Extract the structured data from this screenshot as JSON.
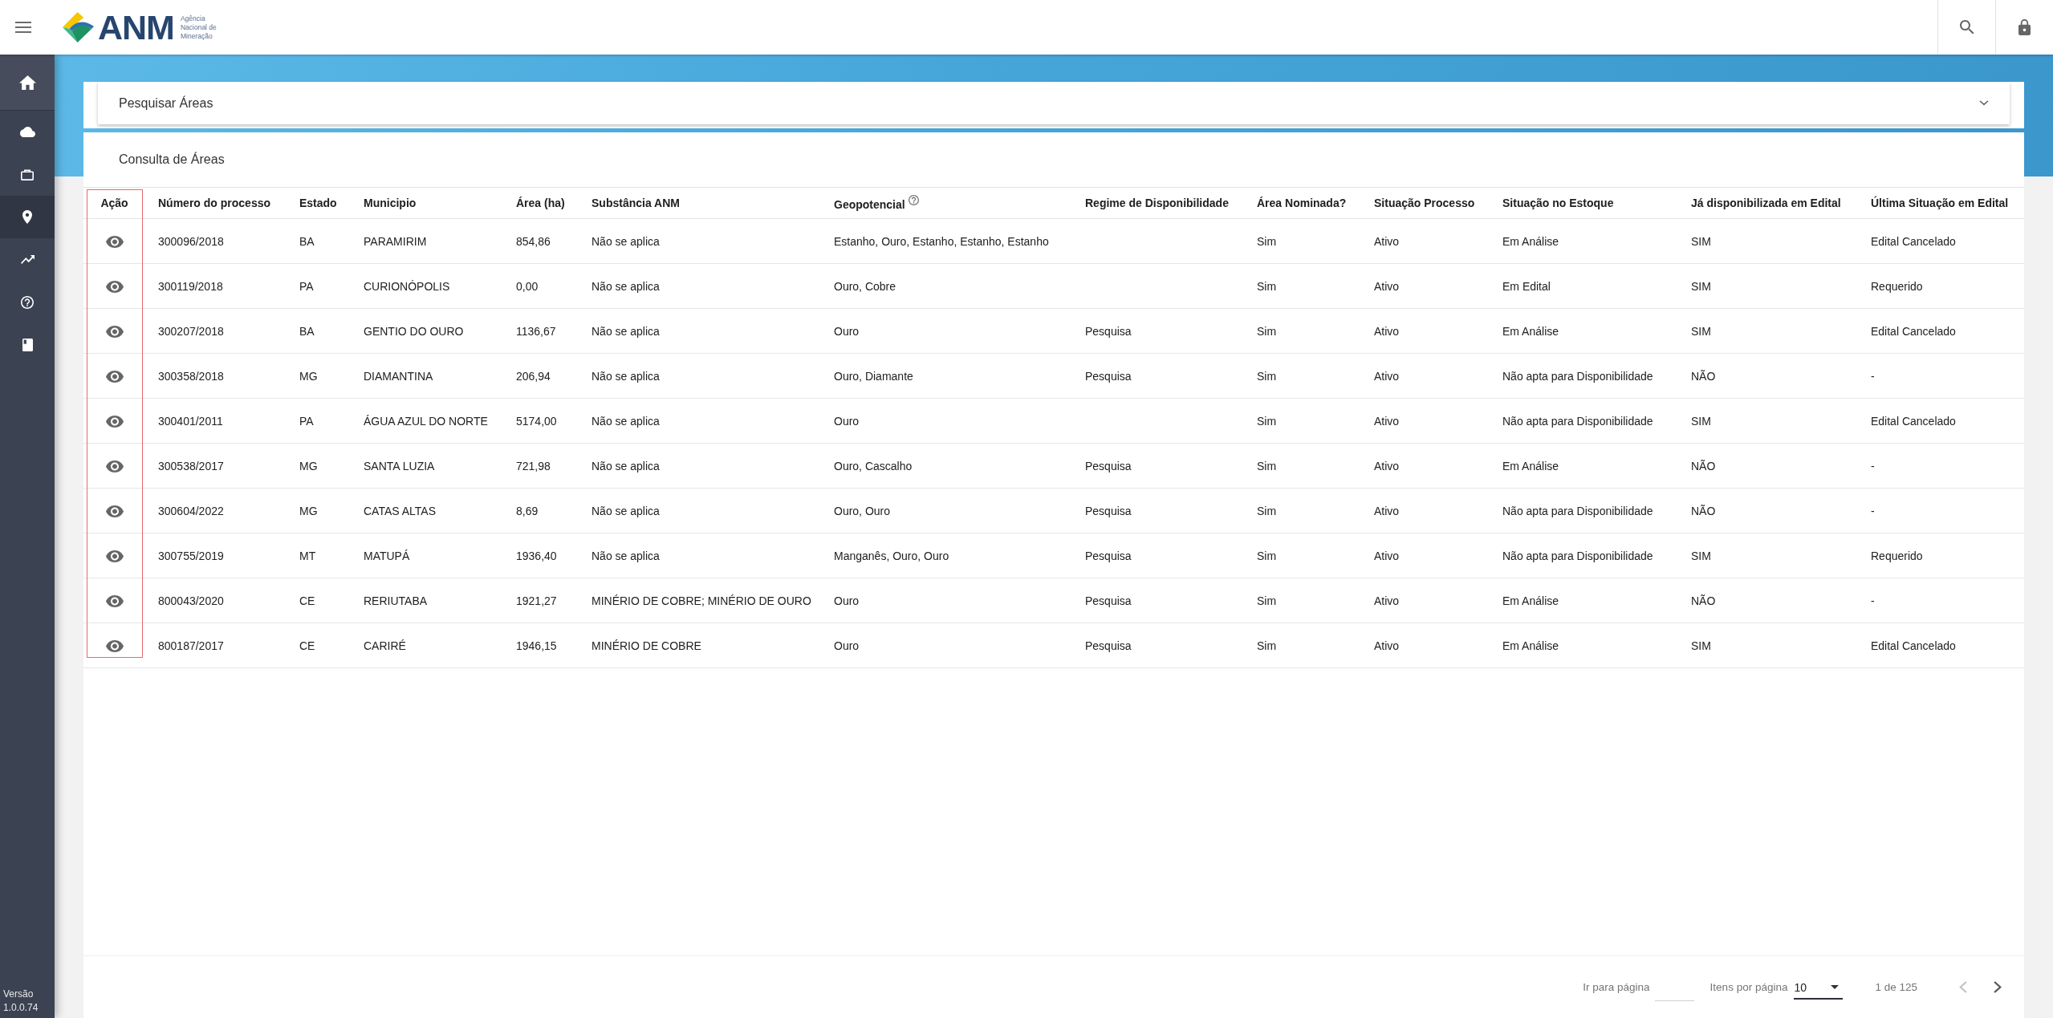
{
  "header": {
    "logo_title": "ANM",
    "logo_subtitle": "Agência Nacional de Mineração"
  },
  "sidebar": {
    "items": [
      {
        "kind": "home",
        "selected": false
      },
      {
        "kind": "cloud",
        "selected": false
      },
      {
        "kind": "briefcase",
        "selected": false
      },
      {
        "kind": "pin",
        "selected": true
      },
      {
        "kind": "trend",
        "selected": false
      },
      {
        "kind": "help",
        "selected": false
      },
      {
        "kind": "book",
        "selected": false
      }
    ],
    "version_label": "Versão",
    "version": "1.0.0.74"
  },
  "search_panel": {
    "title": "Pesquisar Áreas",
    "expanded": false
  },
  "results": {
    "title": "Consulta de Áreas",
    "table": {
      "columns": [
        {
          "kind": "action",
          "label": "Ação",
          "help": false,
          "highlighted": true
        },
        {
          "kind": "text",
          "label": "Número do processo",
          "help": false,
          "highlighted": false
        },
        {
          "kind": "text",
          "label": "Estado",
          "help": false,
          "highlighted": false
        },
        {
          "kind": "text",
          "label": "Municipio",
          "help": false,
          "highlighted": false
        },
        {
          "kind": "text",
          "label": "Área (ha)",
          "help": false,
          "highlighted": false
        },
        {
          "kind": "text",
          "label": "Substância ANM",
          "help": false,
          "highlighted": false
        },
        {
          "kind": "text",
          "label": "Geopotencial",
          "help": true,
          "highlighted": false
        },
        {
          "kind": "text",
          "label": "Regime de Disponibilidade",
          "help": false,
          "highlighted": false
        },
        {
          "kind": "text",
          "label": "Área Nominada?",
          "help": false,
          "highlighted": false
        },
        {
          "kind": "text",
          "label": "Situação Processo",
          "help": false,
          "highlighted": false
        },
        {
          "kind": "text",
          "label": "Situação no Estoque",
          "help": false,
          "highlighted": false
        },
        {
          "kind": "text",
          "label": "Já disponibilizada em Edital",
          "help": false,
          "highlighted": false
        },
        {
          "kind": "text",
          "label": "Última Situação em Edital",
          "help": false,
          "highlighted": false
        }
      ],
      "rows": [
        {
          "process_number": "300096/2018",
          "state": "BA",
          "municipality": "PARAMIRIM",
          "area_ha": "854,86",
          "substance_anm": "Não se aplica",
          "geopotential": "Estanho, Ouro, Estanho, Estanho, Estanho",
          "nominated_area": "Sim",
          "process_status": "Ativo",
          "stock_status": "Em Análise",
          "available_in_edital": "SIM",
          "last_edital_status": "Edital Cancelado"
        },
        {
          "process_number": "300119/2018",
          "state": "PA",
          "municipality": "CURIONÓPOLIS",
          "area_ha": "0,00",
          "substance_anm": "Não se aplica",
          "geopotential": "Ouro, Cobre",
          "nominated_area": "Sim",
          "process_status": "Ativo",
          "stock_status": "Em Edital",
          "available_in_edital": "SIM",
          "last_edital_status": "Requerido"
        },
        {
          "process_number": "300207/2018",
          "state": "BA",
          "municipality": "GENTIO DO OURO",
          "area_ha": "1136,67",
          "substance_anm": "Não se aplica",
          "geopotential": "Ouro",
          "availability_regime": "Pesquisa",
          "nominated_area": "Sim",
          "process_status": "Ativo",
          "stock_status": "Em Análise",
          "available_in_edital": "SIM",
          "last_edital_status": "Edital Cancelado"
        },
        {
          "process_number": "300358/2018",
          "state": "MG",
          "municipality": "DIAMANTINA",
          "area_ha": "206,94",
          "substance_anm": "Não se aplica",
          "geopotential": "Ouro, Diamante",
          "availability_regime": "Pesquisa",
          "nominated_area": "Sim",
          "process_status": "Ativo",
          "stock_status": "Não apta para Disponibilidade",
          "available_in_edital": "NÃO",
          "last_edital_status": "-"
        },
        {
          "process_number": "300401/2011",
          "state": "PA",
          "municipality": "ÁGUA AZUL DO NORTE",
          "area_ha": "5174,00",
          "substance_anm": "Não se aplica",
          "geopotential": "Ouro",
          "nominated_area": "Sim",
          "process_status": "Ativo",
          "stock_status": "Não apta para Disponibilidade",
          "available_in_edital": "SIM",
          "last_edital_status": "Edital Cancelado"
        },
        {
          "process_number": "300538/2017",
          "state": "MG",
          "municipality": "SANTA LUZIA",
          "area_ha": "721,98",
          "substance_anm": "Não se aplica",
          "geopotential": "Ouro, Cascalho",
          "availability_regime": "Pesquisa",
          "nominated_area": "Sim",
          "process_status": "Ativo",
          "stock_status": "Em Análise",
          "available_in_edital": "NÃO",
          "last_edital_status": "-"
        },
        {
          "process_number": "300604/2022",
          "state": "MG",
          "municipality": "CATAS ALTAS",
          "area_ha": "8,69",
          "substance_anm": "Não se aplica",
          "geopotential": "Ouro, Ouro",
          "availability_regime": "Pesquisa",
          "nominated_area": "Sim",
          "process_status": "Ativo",
          "stock_status": "Não apta para Disponibilidade",
          "available_in_edital": "NÃO",
          "last_edital_status": "-"
        },
        {
          "process_number": "300755/2019",
          "state": "MT",
          "municipality": "MATUPÁ",
          "area_ha": "1936,40",
          "substance_anm": "Não se aplica",
          "geopotential": "Manganês, Ouro, Ouro",
          "availability_regime": "Pesquisa",
          "nominated_area": "Sim",
          "process_status": "Ativo",
          "stock_status": "Não apta para Disponibilidade",
          "available_in_edital": "SIM",
          "last_edital_status": "Requerido"
        },
        {
          "process_number": "800043/2020",
          "state": "CE",
          "municipality": "RERIUTABA",
          "area_ha": "1921,27",
          "substance_anm": "MINÉRIO DE COBRE; MINÉRIO DE OURO",
          "geopotential": "Ouro",
          "availability_regime": "Pesquisa",
          "nominated_area": "Sim",
          "process_status": "Ativo",
          "stock_status": "Em Análise",
          "available_in_edital": "NÃO",
          "last_edital_status": "-"
        },
        {
          "process_number": "800187/2017",
          "state": "CE",
          "municipality": "CARIRÉ",
          "area_ha": "1946,15",
          "substance_anm": "MINÉRIO DE COBRE",
          "geopotential": "Ouro",
          "availability_regime": "Pesquisa",
          "nominated_area": "Sim",
          "process_status": "Ativo",
          "stock_status": "Em Análise",
          "available_in_edital": "SIM",
          "last_edital_status": "Edital Cancelado"
        }
      ]
    }
  },
  "pagination": {
    "goto_label": "Ir para página",
    "per_page_label": "Itens por página",
    "per_page": "10",
    "page_range": "1 de 125",
    "prev_disabled": true,
    "next_disabled": false
  }
}
